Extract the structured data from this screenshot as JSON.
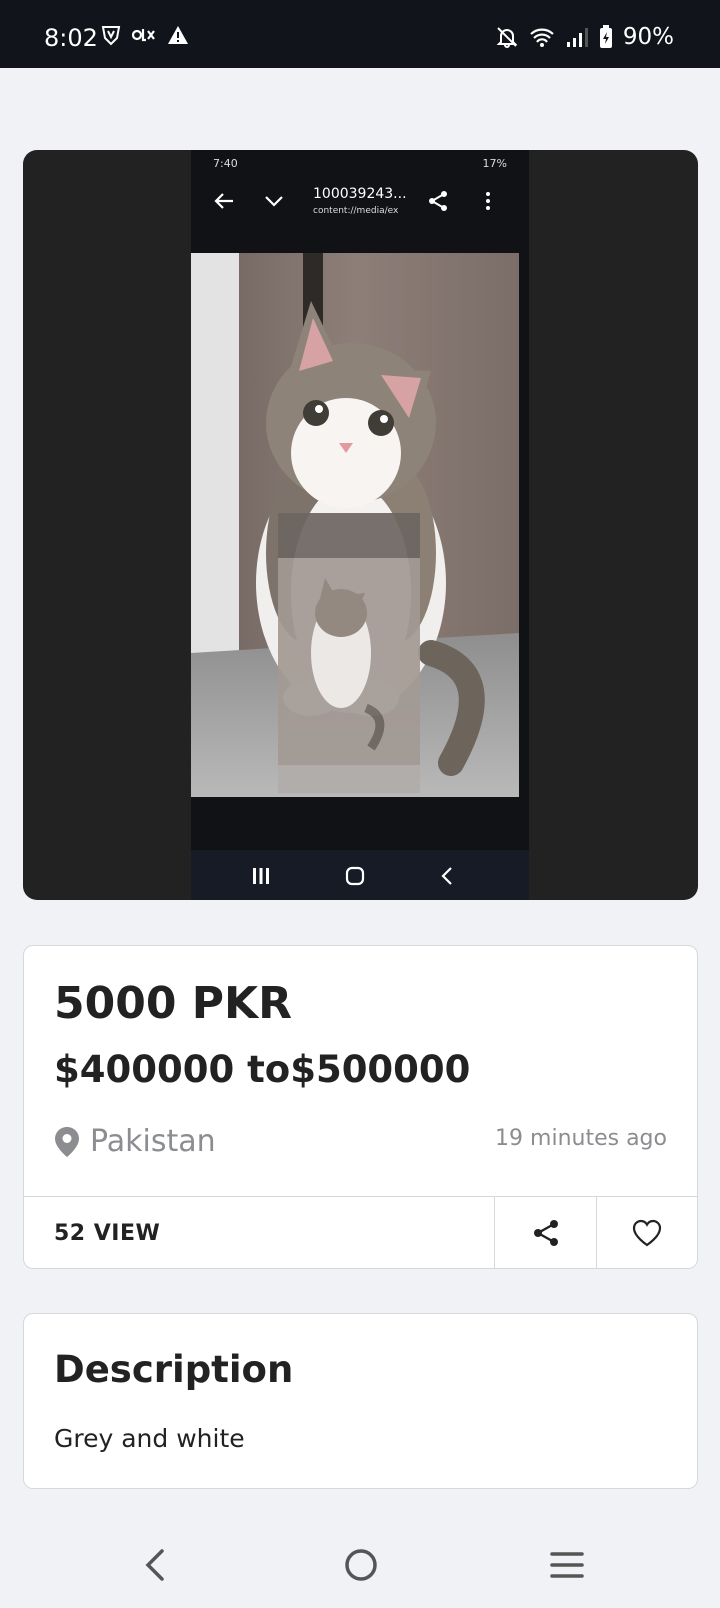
{
  "status_bar": {
    "time": "8:02",
    "battery": "90%"
  },
  "gallery": {
    "inner_status_time": "7:40",
    "inner_status_battery": "17%",
    "inner_title": "100039243...",
    "inner_subtitle": "content://media/ex"
  },
  "listing": {
    "price": "5000 PKR",
    "price_range": "$400000 to$500000",
    "location": "Pakistan",
    "posted": "19 minutes ago",
    "views": "52 VIEW"
  },
  "description": {
    "title": "Description",
    "text": "Grey and white"
  },
  "colors": {
    "background": "#f1f2f6",
    "status_bar": "#11141b",
    "gallery_bg": "#222222",
    "text": "#222222",
    "muted": "#8b8d91"
  }
}
